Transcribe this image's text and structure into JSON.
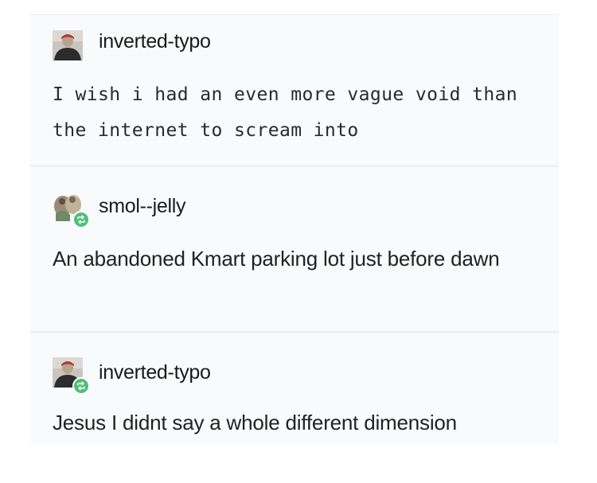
{
  "posts": [
    {
      "username": "inverted-typo",
      "avatar_icon": "user-avatar-icon",
      "text": "I wish i had an even more vague void than the internet to scream into"
    },
    {
      "username": "smol--jelly",
      "avatar_icon": "user-avatar-icon",
      "badge_icon": "reblog-icon",
      "text": "An abandoned Kmart parking lot just before dawn"
    },
    {
      "username": "inverted-typo",
      "avatar_icon": "user-avatar-icon",
      "badge_icon": "reblog-icon",
      "text": "Jesus I didnt say a whole different dimension"
    }
  ],
  "colors": {
    "post_background": "#f9fafc",
    "reblog_badge": "#4cbf79",
    "text": "#222222"
  }
}
